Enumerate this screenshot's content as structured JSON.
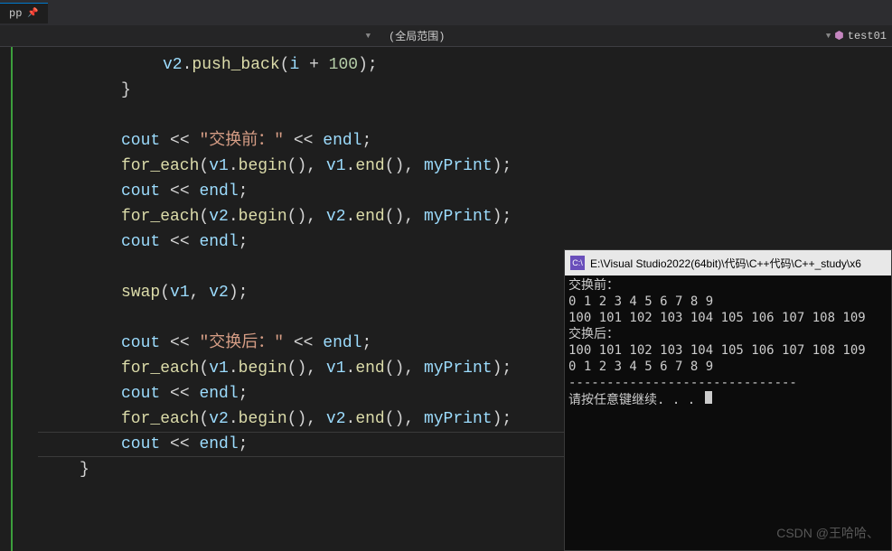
{
  "tab": {
    "name": "pp",
    "pin_icon": "📌"
  },
  "navbar": {
    "scope": "(全局范围)",
    "project": "test01",
    "cube_icon": "⬢"
  },
  "code": {
    "lines": [
      {
        "indent": 3,
        "tokens": [
          {
            "t": "v",
            "v": "v2"
          },
          {
            "t": "p",
            "v": "."
          },
          {
            "t": "f",
            "v": "push_back"
          },
          {
            "t": "p",
            "v": "("
          },
          {
            "t": "v",
            "v": "i"
          },
          {
            "t": "p",
            "v": " + "
          },
          {
            "t": "n",
            "v": "100"
          },
          {
            "t": "p",
            "v": ");"
          }
        ]
      },
      {
        "indent": 2,
        "tokens": [
          {
            "t": "p",
            "v": "}"
          }
        ]
      },
      {
        "indent": 0,
        "tokens": []
      },
      {
        "indent": 2,
        "tokens": [
          {
            "t": "v",
            "v": "cout"
          },
          {
            "t": "p",
            "v": " << "
          },
          {
            "t": "s",
            "v": "\"交换前：\""
          },
          {
            "t": "p",
            "v": " << "
          },
          {
            "t": "v",
            "v": "endl"
          },
          {
            "t": "p",
            "v": ";"
          }
        ]
      },
      {
        "indent": 2,
        "tokens": [
          {
            "t": "f",
            "v": "for_each"
          },
          {
            "t": "p",
            "v": "("
          },
          {
            "t": "v",
            "v": "v1"
          },
          {
            "t": "p",
            "v": "."
          },
          {
            "t": "f",
            "v": "begin"
          },
          {
            "t": "p",
            "v": "(), "
          },
          {
            "t": "v",
            "v": "v1"
          },
          {
            "t": "p",
            "v": "."
          },
          {
            "t": "f",
            "v": "end"
          },
          {
            "t": "p",
            "v": "(), "
          },
          {
            "t": "v",
            "v": "myPrint"
          },
          {
            "t": "p",
            "v": ");"
          }
        ]
      },
      {
        "indent": 2,
        "tokens": [
          {
            "t": "v",
            "v": "cout"
          },
          {
            "t": "p",
            "v": " << "
          },
          {
            "t": "v",
            "v": "endl"
          },
          {
            "t": "p",
            "v": ";"
          }
        ]
      },
      {
        "indent": 2,
        "tokens": [
          {
            "t": "f",
            "v": "for_each"
          },
          {
            "t": "p",
            "v": "("
          },
          {
            "t": "v",
            "v": "v2"
          },
          {
            "t": "p",
            "v": "."
          },
          {
            "t": "f",
            "v": "begin"
          },
          {
            "t": "p",
            "v": "(), "
          },
          {
            "t": "v",
            "v": "v2"
          },
          {
            "t": "p",
            "v": "."
          },
          {
            "t": "f",
            "v": "end"
          },
          {
            "t": "p",
            "v": "(), "
          },
          {
            "t": "v",
            "v": "myPrint"
          },
          {
            "t": "p",
            "v": ");"
          }
        ]
      },
      {
        "indent": 2,
        "tokens": [
          {
            "t": "v",
            "v": "cout"
          },
          {
            "t": "p",
            "v": " << "
          },
          {
            "t": "v",
            "v": "endl"
          },
          {
            "t": "p",
            "v": ";"
          }
        ]
      },
      {
        "indent": 0,
        "tokens": []
      },
      {
        "indent": 2,
        "tokens": [
          {
            "t": "f",
            "v": "swap"
          },
          {
            "t": "p",
            "v": "("
          },
          {
            "t": "v",
            "v": "v1"
          },
          {
            "t": "p",
            "v": ", "
          },
          {
            "t": "v",
            "v": "v2"
          },
          {
            "t": "p",
            "v": ");"
          }
        ]
      },
      {
        "indent": 0,
        "tokens": []
      },
      {
        "indent": 2,
        "tokens": [
          {
            "t": "v",
            "v": "cout"
          },
          {
            "t": "p",
            "v": " << "
          },
          {
            "t": "s",
            "v": "\"交换后：\""
          },
          {
            "t": "p",
            "v": " << "
          },
          {
            "t": "v",
            "v": "endl"
          },
          {
            "t": "p",
            "v": ";"
          }
        ]
      },
      {
        "indent": 2,
        "tokens": [
          {
            "t": "f",
            "v": "for_each"
          },
          {
            "t": "p",
            "v": "("
          },
          {
            "t": "v",
            "v": "v1"
          },
          {
            "t": "p",
            "v": "."
          },
          {
            "t": "f",
            "v": "begin"
          },
          {
            "t": "p",
            "v": "(), "
          },
          {
            "t": "v",
            "v": "v1"
          },
          {
            "t": "p",
            "v": "."
          },
          {
            "t": "f",
            "v": "end"
          },
          {
            "t": "p",
            "v": "(), "
          },
          {
            "t": "v",
            "v": "myPrint"
          },
          {
            "t": "p",
            "v": ");"
          }
        ]
      },
      {
        "indent": 2,
        "tokens": [
          {
            "t": "v",
            "v": "cout"
          },
          {
            "t": "p",
            "v": " << "
          },
          {
            "t": "v",
            "v": "endl"
          },
          {
            "t": "p",
            "v": ";"
          }
        ]
      },
      {
        "indent": 2,
        "tokens": [
          {
            "t": "f",
            "v": "for_each"
          },
          {
            "t": "p",
            "v": "("
          },
          {
            "t": "v",
            "v": "v2"
          },
          {
            "t": "p",
            "v": "."
          },
          {
            "t": "f",
            "v": "begin"
          },
          {
            "t": "p",
            "v": "(), "
          },
          {
            "t": "v",
            "v": "v2"
          },
          {
            "t": "p",
            "v": "."
          },
          {
            "t": "f",
            "v": "end"
          },
          {
            "t": "p",
            "v": "(), "
          },
          {
            "t": "v",
            "v": "myPrint"
          },
          {
            "t": "p",
            "v": ");"
          }
        ]
      },
      {
        "indent": 2,
        "tokens": [
          {
            "t": "v",
            "v": "cout"
          },
          {
            "t": "p",
            "v": " << "
          },
          {
            "t": "v",
            "v": "endl"
          },
          {
            "t": "p",
            "v": ";"
          }
        ],
        "cursor": true
      },
      {
        "indent": 1,
        "tokens": [
          {
            "t": "p",
            "v": "}"
          }
        ]
      }
    ]
  },
  "console": {
    "icon_text": "C:\\",
    "title": "E:\\Visual Studio2022(64bit)\\代码\\C++代码\\C++_study\\x6",
    "output": [
      "交换前：",
      "0 1 2 3 4 5 6 7 8 9",
      "100 101 102 103 104 105 106 107 108 109",
      "交换后：",
      "100 101 102 103 104 105 106 107 108 109",
      "0 1 2 3 4 5 6 7 8 9",
      "------------------------------",
      "请按任意键继续. . . "
    ]
  },
  "watermark": "CSDN @王哈哈、"
}
